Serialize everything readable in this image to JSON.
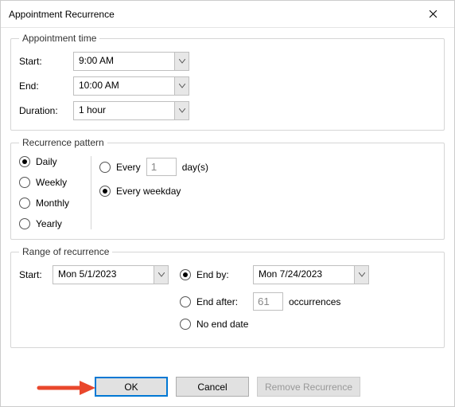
{
  "title": "Appointment Recurrence",
  "appt_time": {
    "legend": "Appointment time",
    "start_label": "Start:",
    "start_value": "9:00 AM",
    "end_label": "End:",
    "end_value": "10:00 AM",
    "duration_label": "Duration:",
    "duration_value": "1 hour"
  },
  "pattern": {
    "legend": "Recurrence pattern",
    "daily": "Daily",
    "weekly": "Weekly",
    "monthly": "Monthly",
    "yearly": "Yearly",
    "every_label": "Every",
    "every_value": "1",
    "days_label": "day(s)",
    "every_weekday": "Every weekday"
  },
  "range": {
    "legend": "Range of recurrence",
    "start_label": "Start:",
    "start_value": "Mon 5/1/2023",
    "end_by_label": "End by:",
    "end_by_value": "Mon 7/24/2023",
    "end_after_label": "End after:",
    "end_after_value": "61",
    "occurrences": "occurrences",
    "no_end": "No end date"
  },
  "buttons": {
    "ok": "OK",
    "cancel": "Cancel",
    "remove": "Remove Recurrence"
  }
}
